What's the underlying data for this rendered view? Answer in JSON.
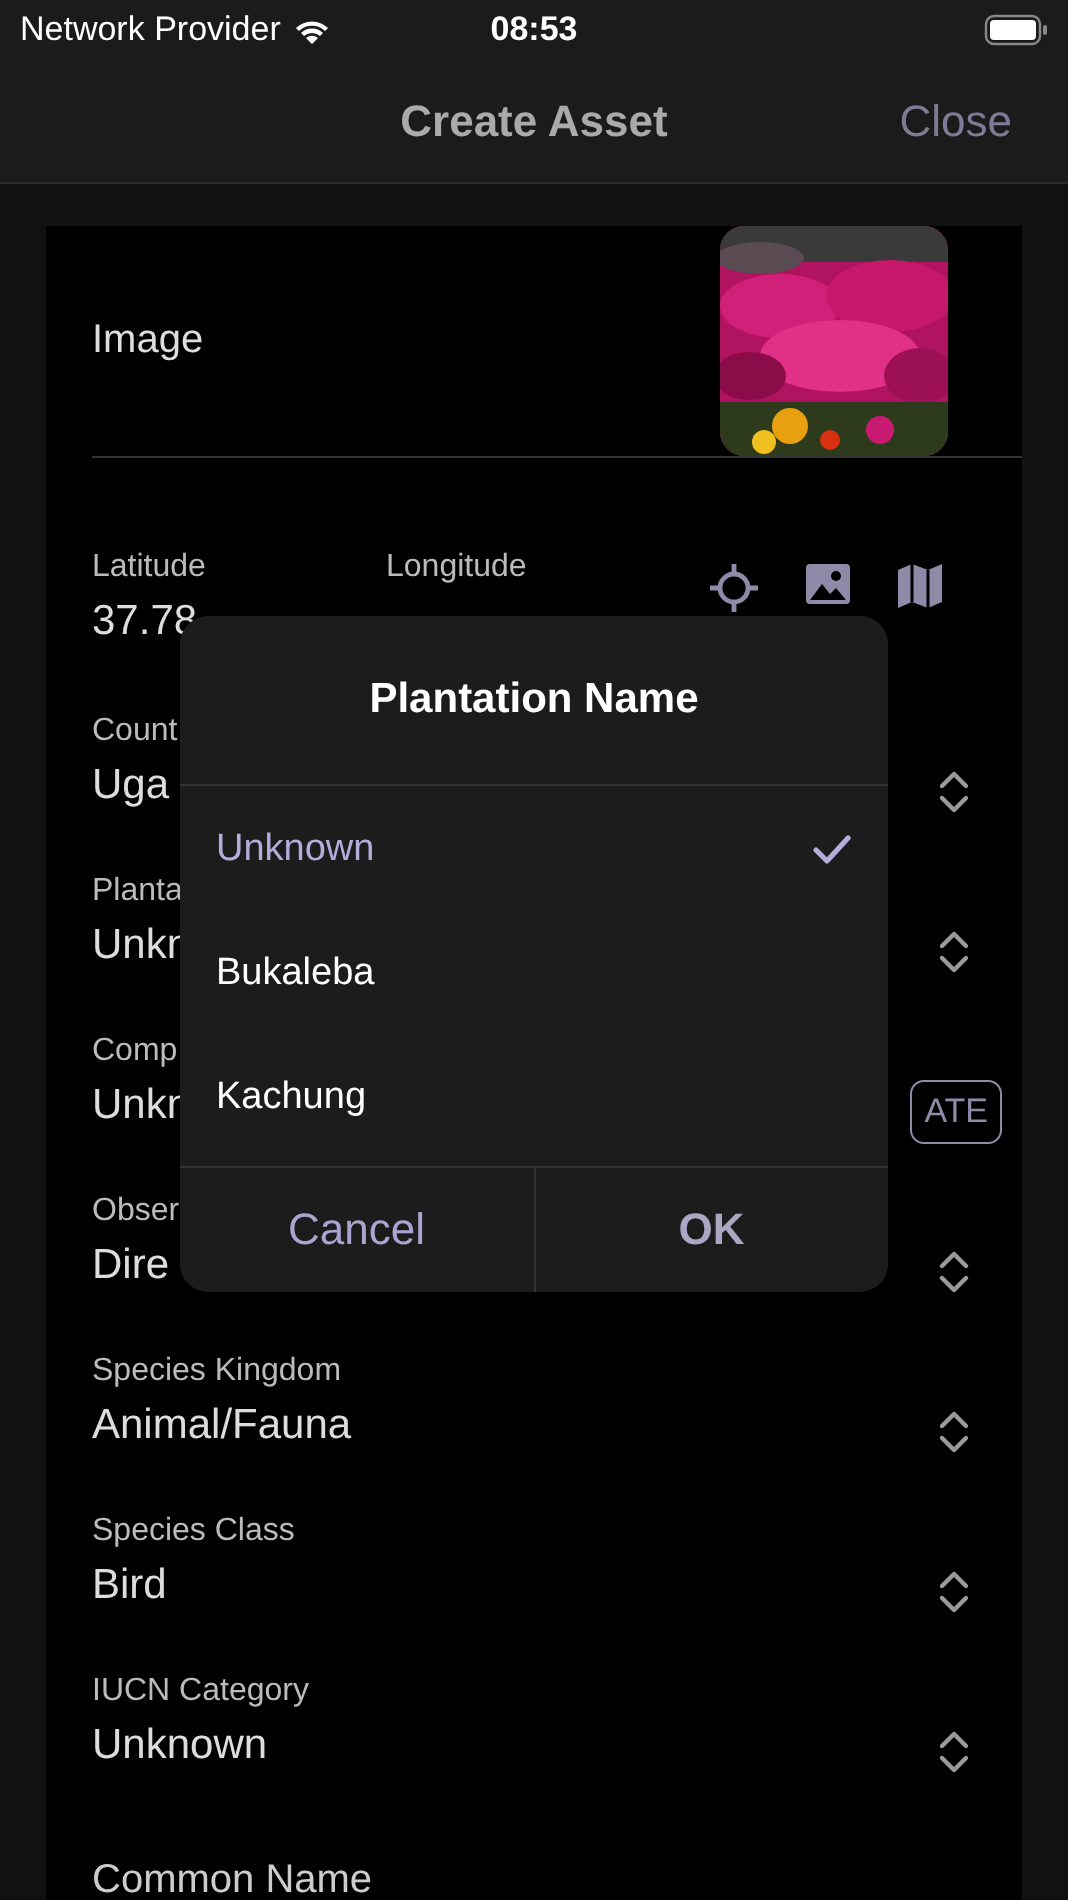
{
  "status_bar": {
    "carrier": "Network Provider",
    "time": "08:53"
  },
  "nav": {
    "title": "Create Asset",
    "close": "Close"
  },
  "form": {
    "image_label": "Image",
    "location": {
      "latitude_label": "Latitude",
      "latitude": "37.78",
      "longitude_label": "Longitude"
    },
    "fields": [
      {
        "kind": "picker",
        "label": "Count",
        "value": "Uga"
      },
      {
        "kind": "picker",
        "label": "Planta",
        "value": "Unkn"
      },
      {
        "kind": "action",
        "label": "Comp",
        "value": "Unkn",
        "action": "ATE"
      },
      {
        "kind": "picker",
        "label": "Obser",
        "value": "Dire"
      },
      {
        "kind": "picker",
        "label": "Species Kingdom",
        "value": "Animal/Fauna"
      },
      {
        "kind": "picker",
        "label": "Species Class",
        "value": "Bird"
      },
      {
        "kind": "picker",
        "label": "IUCN Category",
        "value": "Unknown"
      },
      {
        "kind": "text",
        "label": "Common Name"
      }
    ]
  },
  "dialog": {
    "title": "Plantation Name",
    "options": [
      {
        "label": "Unknown",
        "selected": true
      },
      {
        "label": "Bukaleba",
        "selected": false
      },
      {
        "label": "Kachung",
        "selected": false
      }
    ],
    "buttons": [
      {
        "label": "Cancel",
        "kind": "cancel"
      },
      {
        "label": "OK",
        "kind": "confirm"
      }
    ]
  }
}
